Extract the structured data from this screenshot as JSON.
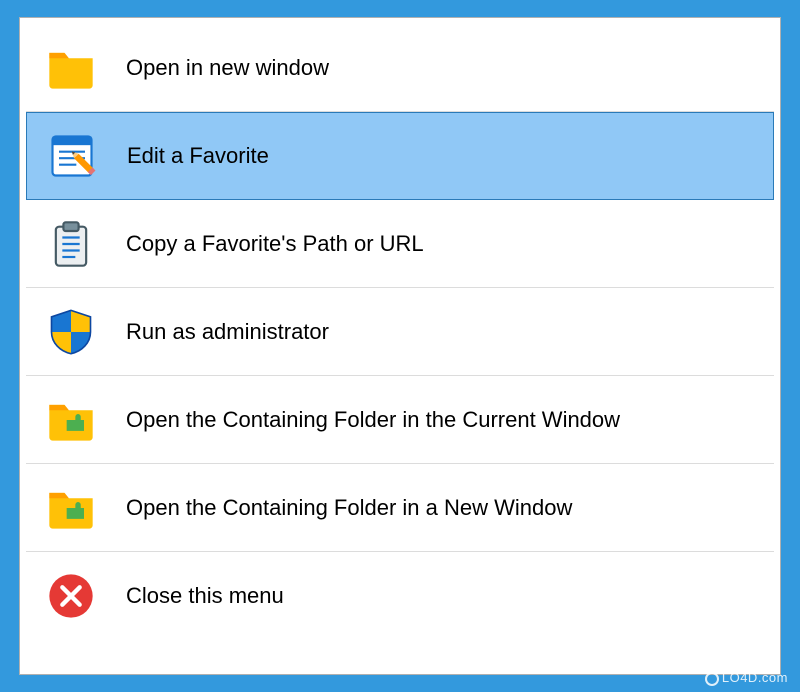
{
  "menu": {
    "items": [
      {
        "label": "Open in new window",
        "highlighted": false
      },
      {
        "label": "Edit a Favorite",
        "highlighted": true
      },
      {
        "label": "Copy a Favorite's Path or URL",
        "highlighted": false
      },
      {
        "label": "Run as administrator",
        "highlighted": false
      },
      {
        "label": "Open the Containing Folder in the Current Window",
        "highlighted": false
      },
      {
        "label": "Open the Containing Folder in a New Window",
        "highlighted": false
      },
      {
        "label": "Close this menu",
        "highlighted": false
      }
    ]
  },
  "watermark": "LO4D.com"
}
